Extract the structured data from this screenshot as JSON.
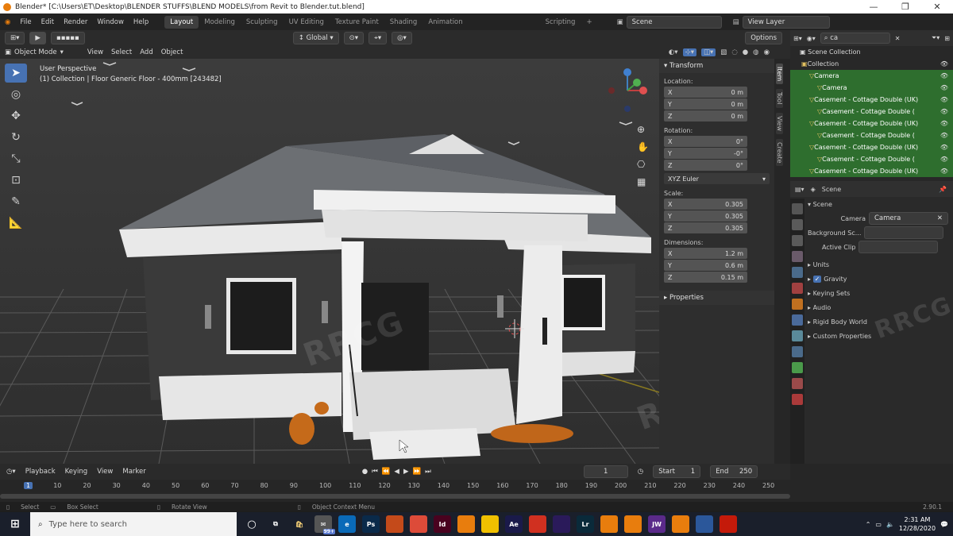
{
  "window": {
    "title": "Blender* [C:\\Users\\ET\\Desktop\\BLENDER STUFFS\\BLEND MODELS\\from Revit to  Blender.tut.blend]",
    "controls": [
      "—",
      "❐",
      "✕"
    ]
  },
  "menu": [
    "File",
    "Edit",
    "Render",
    "Window",
    "Help"
  ],
  "workspaces": {
    "tabs": [
      "Layout",
      "Modeling",
      "Sculpting",
      "UV Editing",
      "Texture Paint",
      "Shading",
      "Animation"
    ],
    "active": "Layout",
    "trailing": "Scripting",
    "add": "+"
  },
  "top_right": {
    "scene": "Scene",
    "view_layer": "View Layer"
  },
  "viewport_header": {
    "orientation": "Global",
    "options": "Options",
    "mode": "Object Mode",
    "menus": [
      "View",
      "Select",
      "Add",
      "Object"
    ]
  },
  "viewport": {
    "perspective_label": "User Perspective",
    "collection_label": "(1) Collection | Floor Generic Floor - 400mm [243482]"
  },
  "npanel": {
    "header": "Transform",
    "location_label": "Location:",
    "location": [
      {
        "axis": "X",
        "value": "0 m"
      },
      {
        "axis": "Y",
        "value": "0 m"
      },
      {
        "axis": "Z",
        "value": "0 m"
      }
    ],
    "rotation_label": "Rotation:",
    "rotation": [
      {
        "axis": "X",
        "value": "0°"
      },
      {
        "axis": "Y",
        "value": "-0°"
      },
      {
        "axis": "Z",
        "value": "0°"
      }
    ],
    "rotation_mode": "XYZ Euler",
    "scale_label": "Scale:",
    "scale": [
      {
        "axis": "X",
        "value": "0.305"
      },
      {
        "axis": "Y",
        "value": "0.305"
      },
      {
        "axis": "Z",
        "value": "0.305"
      }
    ],
    "dimensions_label": "Dimensions:",
    "dimensions": [
      {
        "axis": "X",
        "value": "1.2 m"
      },
      {
        "axis": "Y",
        "value": "0.6 m"
      },
      {
        "axis": "Z",
        "value": "0.15 m"
      }
    ],
    "properties": "Properties",
    "side_tabs": [
      "Item",
      "Tool",
      "View",
      "Create"
    ]
  },
  "outliner": {
    "search": "ca",
    "root": "Scene Collection",
    "rows": [
      {
        "label": "Collection",
        "indent": 1,
        "sel": false
      },
      {
        "label": "Camera",
        "indent": 2,
        "sel": true
      },
      {
        "label": "Camera",
        "indent": 3,
        "sel": true
      },
      {
        "label": "Casement - Cottage Double (UK)",
        "indent": 2,
        "sel": true
      },
      {
        "label": "Casement - Cottage Double (",
        "indent": 3,
        "sel": true
      },
      {
        "label": "Casement - Cottage Double (UK)",
        "indent": 2,
        "sel": true
      },
      {
        "label": "Casement - Cottage Double (",
        "indent": 3,
        "sel": true
      },
      {
        "label": "Casement - Cottage Double (UK)",
        "indent": 2,
        "sel": true
      },
      {
        "label": "Casement - Cottage Double (",
        "indent": 3,
        "sel": true
      },
      {
        "label": "Casement - Cottage Double (UK)",
        "indent": 2,
        "sel": true
      }
    ]
  },
  "properties": {
    "context": "Scene",
    "section": "Scene",
    "camera_label": "Camera",
    "camera_value": "Camera",
    "bg_label": "Background Sc...",
    "clip_label": "Active Clip",
    "panels": [
      "Units",
      "Gravity",
      "Keying Sets",
      "Audio",
      "Rigid Body World",
      "Custom Properties"
    ]
  },
  "timeline": {
    "menus": [
      "Playback",
      "Keying",
      "View",
      "Marker"
    ],
    "current_frame": "1",
    "start_label": "Start",
    "start": "1",
    "end_label": "End",
    "end": "250",
    "ticks": [
      "1",
      "10",
      "20",
      "30",
      "40",
      "50",
      "60",
      "70",
      "80",
      "90",
      "100",
      "110",
      "120",
      "130",
      "140",
      "150",
      "160",
      "170",
      "180",
      "190",
      "200",
      "210",
      "220",
      "230",
      "240",
      "250"
    ]
  },
  "status": {
    "select": "Select",
    "box_select": "Box Select",
    "rotate": "Rotate View",
    "context_menu": "Object Context Menu",
    "version": "2.90.1"
  },
  "taskbar": {
    "search_placeholder": "Type here to search",
    "time": "2:31 AM",
    "date": "12/28/2020",
    "notif_badge": "99+",
    "apps": [
      {
        "label": "Ps",
        "color": "#0a2a4a"
      },
      {
        "label": "",
        "color": "#c44a1a"
      },
      {
        "label": "",
        "color": "#dd4b39"
      },
      {
        "label": "Id",
        "color": "#49021f"
      },
      {
        "label": "",
        "color": "#e87d0d"
      },
      {
        "label": "",
        "color": "#f0c000"
      },
      {
        "label": "Ae",
        "color": "#1a1a4a"
      },
      {
        "label": "",
        "color": "#d03020"
      },
      {
        "label": "",
        "color": "#2a1a5a"
      },
      {
        "label": "Lr",
        "color": "#0a2a3a"
      },
      {
        "label": "",
        "color": "#e87d0d"
      },
      {
        "label": "",
        "color": "#e87d0d"
      },
      {
        "label": "JW",
        "color": "#5a2a8a"
      },
      {
        "label": "",
        "color": "#e87d0d"
      },
      {
        "label": "",
        "color": "#2b579a"
      },
      {
        "label": "",
        "color": "#c41a0a"
      }
    ]
  },
  "watermark": "RRCG"
}
